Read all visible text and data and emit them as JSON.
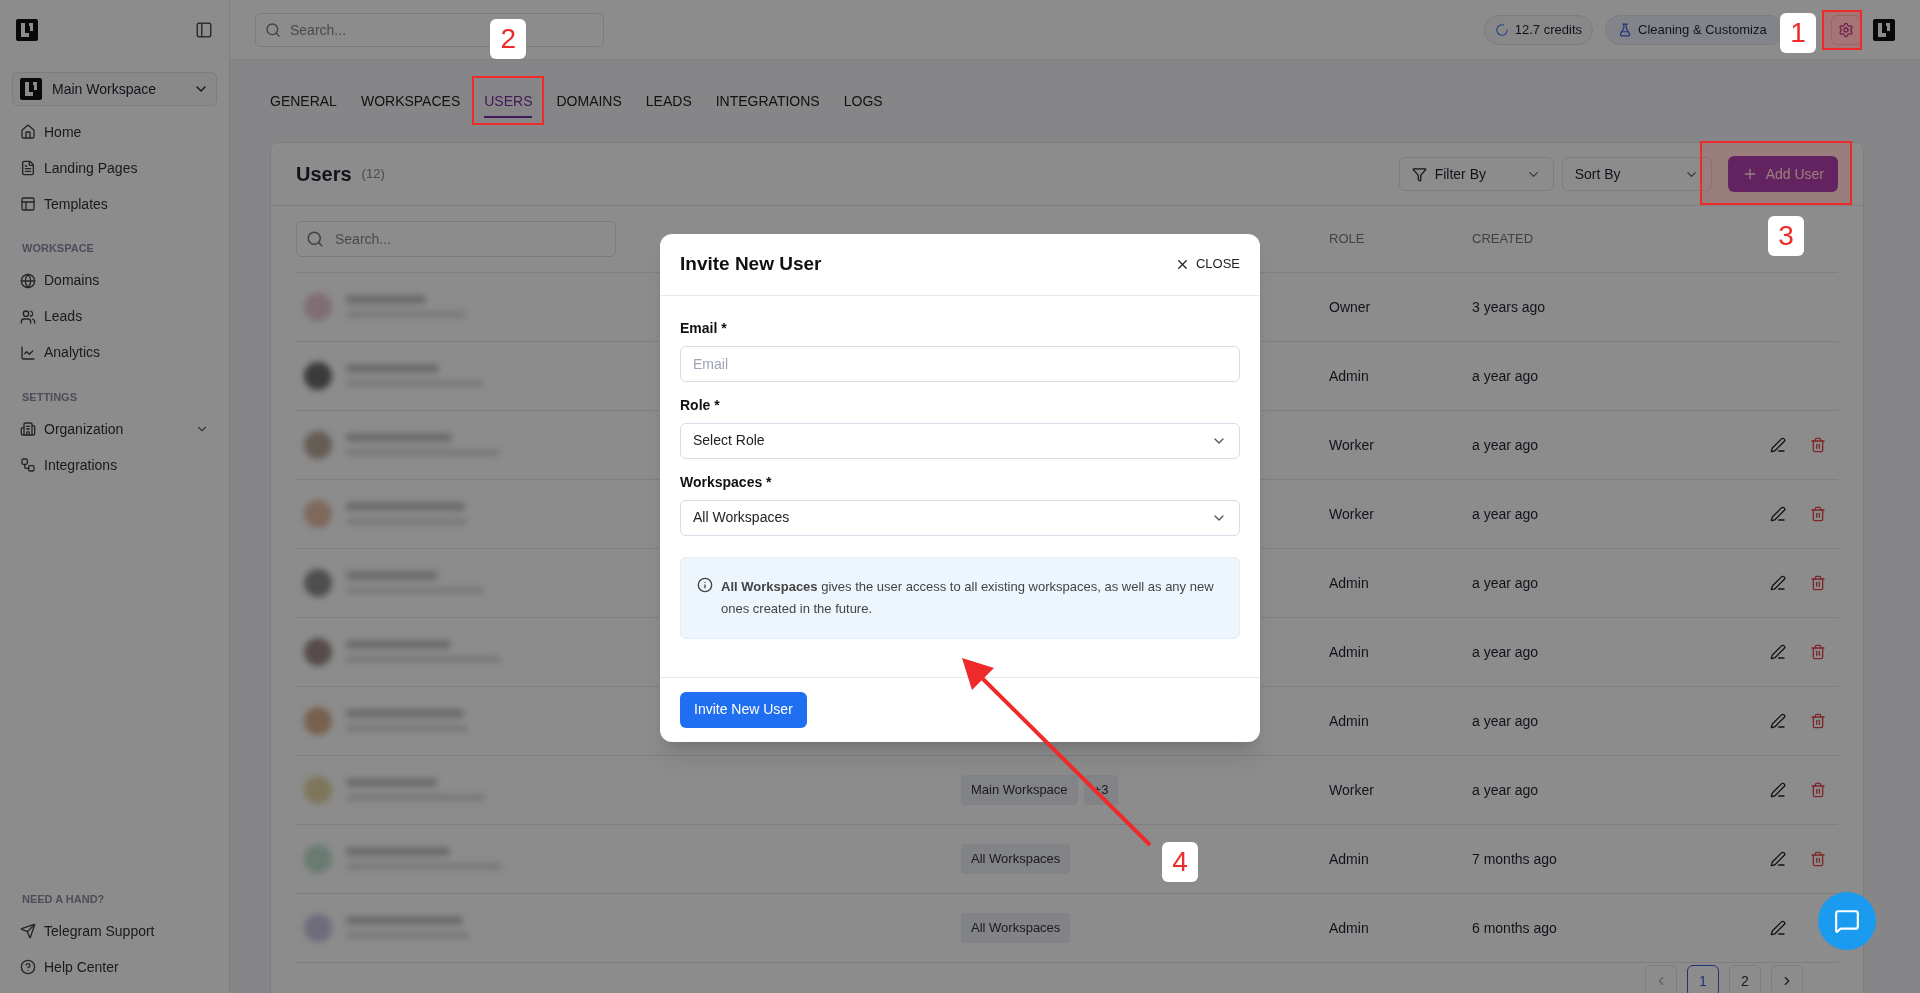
{
  "sidebar": {
    "workspace": "Main Workspace",
    "sections": [
      {
        "items": [
          {
            "label": "Home"
          },
          {
            "label": "Landing Pages"
          },
          {
            "label": "Templates"
          }
        ]
      },
      {
        "heading": "WORKSPACE",
        "items": [
          {
            "label": "Domains"
          },
          {
            "label": "Leads"
          },
          {
            "label": "Analytics"
          }
        ]
      },
      {
        "heading": "SETTINGS",
        "items": [
          {
            "label": "Organization",
            "expanded": false
          },
          {
            "label": "Integrations"
          }
        ]
      }
    ],
    "help": {
      "heading": "NEED A HAND?",
      "items": [
        {
          "label": "Telegram Support"
        },
        {
          "label": "Help Center"
        }
      ]
    }
  },
  "topbar": {
    "search": {
      "placeholder": "Search..."
    },
    "credits": "12.7 credits",
    "project": "Cleaning & Customiza"
  },
  "tabs": [
    {
      "label": "GENERAL",
      "selected": false
    },
    {
      "label": "WORKSPACES",
      "selected": false
    },
    {
      "label": "USERS",
      "selected": true
    },
    {
      "label": "DOMAINS",
      "selected": false
    },
    {
      "label": "LEADS",
      "selected": false
    },
    {
      "label": "INTEGRATIONS",
      "selected": false
    },
    {
      "label": "LOGS",
      "selected": false
    }
  ],
  "users": {
    "title": "Users",
    "count": "(12)",
    "filter": "Filter By",
    "sort": "Sort By",
    "add_button": "Add User",
    "search": {
      "placeholder": "Search..."
    },
    "columns": [
      {
        "label": "ROLE"
      },
      {
        "label": "CREATED"
      }
    ],
    "rows": [
      {
        "workspaces": [],
        "role": "Owner",
        "created": "3 years ago",
        "editable": false,
        "deletable": false
      },
      {
        "workspaces": [],
        "role": "Admin",
        "created": "a year ago",
        "editable": false,
        "deletable": false
      },
      {
        "workspaces": [],
        "role": "Worker",
        "created": "a year ago",
        "editable": true,
        "deletable": true
      },
      {
        "workspaces": [],
        "role": "Worker",
        "created": "a year ago",
        "editable": true,
        "deletable": true
      },
      {
        "workspaces": [],
        "role": "Admin",
        "created": "a year ago",
        "editable": true,
        "deletable": true
      },
      {
        "workspaces": [],
        "role": "Admin",
        "created": "a year ago",
        "editable": true,
        "deletable": true
      },
      {
        "workspaces": [],
        "role": "Admin",
        "created": "a year ago",
        "editable": true,
        "deletable": true
      },
      {
        "workspaces": [
          "Main Workspace",
          "+3"
        ],
        "role": "Worker",
        "created": "a year ago",
        "editable": true,
        "deletable": true
      },
      {
        "workspaces": [
          "All Workspaces"
        ],
        "role": "Admin",
        "created": "7 months ago",
        "editable": true,
        "deletable": true
      },
      {
        "workspaces": [
          "All Workspaces"
        ],
        "role": "Admin",
        "created": "6 months ago",
        "editable": true
      }
    ],
    "pages": [
      {
        "label": "1",
        "selected": true
      },
      {
        "label": "2",
        "selected": false
      }
    ]
  },
  "modal": {
    "title": "Invite New User",
    "close": "CLOSE",
    "fields": [
      {
        "kind": "input",
        "label": "Email *",
        "placeholder": "Email"
      },
      {
        "kind": "select",
        "label": "Role *",
        "value": "Select Role"
      },
      {
        "kind": "select",
        "label": "Workspaces *",
        "value": "All Workspaces"
      }
    ],
    "info": "**All Workspaces** gives the user access to all existing workspaces, as well as any new ones created in the future.",
    "submit": "Invite New User"
  },
  "annotations": [
    {
      "label": "1"
    },
    {
      "label": "2"
    },
    {
      "label": "3"
    },
    {
      "label": "4"
    }
  ]
}
